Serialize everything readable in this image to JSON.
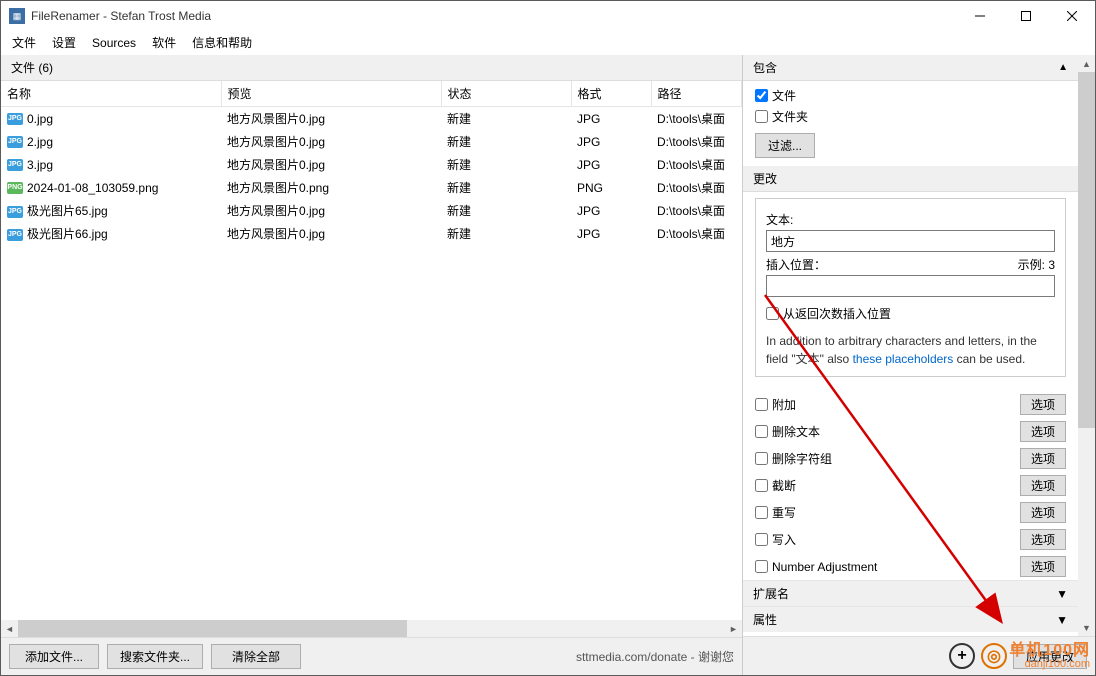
{
  "titlebar": {
    "title": "FileRenamer - Stefan Trost Media"
  },
  "menu": {
    "items": [
      "文件",
      "设置",
      "Sources",
      "软件",
      "信息和帮助"
    ]
  },
  "filelist": {
    "header_label": "文件 (6)",
    "columns": [
      "名称",
      "预览",
      "状态",
      "格式",
      "路径"
    ],
    "rows": [
      {
        "icon": "jpg",
        "name": "0.jpg",
        "preview": "地方风景图片0.jpg",
        "status": "新建",
        "format": "JPG",
        "path": "D:\\tools\\桌面"
      },
      {
        "icon": "jpg",
        "name": "2.jpg",
        "preview": "地方风景图片0.jpg",
        "status": "新建",
        "format": "JPG",
        "path": "D:\\tools\\桌面"
      },
      {
        "icon": "jpg",
        "name": "3.jpg",
        "preview": "地方风景图片0.jpg",
        "status": "新建",
        "format": "JPG",
        "path": "D:\\tools\\桌面"
      },
      {
        "icon": "png",
        "name": "2024-01-08_103059.png",
        "preview": "地方风景图片0.png",
        "status": "新建",
        "format": "PNG",
        "path": "D:\\tools\\桌面"
      },
      {
        "icon": "jpg",
        "name": "极光图片65.jpg",
        "preview": "地方风景图片0.jpg",
        "status": "新建",
        "format": "JPG",
        "path": "D:\\tools\\桌面"
      },
      {
        "icon": "jpg",
        "name": "极光图片66.jpg",
        "preview": "地方风景图片0.jpg",
        "status": "新建",
        "format": "JPG",
        "path": "D:\\tools\\桌面"
      }
    ]
  },
  "bottom": {
    "add_files": "添加文件...",
    "search_files": "搜索文件夹...",
    "clear_all": "清除全部",
    "donate": "sttmedia.com/donate - 谢谢您"
  },
  "right": {
    "include": {
      "header": "包含",
      "files": "文件",
      "folders": "文件夹",
      "filter": "过滤..."
    },
    "change": {
      "header": "更改",
      "text_label": "文本:",
      "text_value": "地方",
      "pos_label": "插入位置：",
      "example_label": "示例: 3",
      "pos_value": "",
      "return_chk": "从返回次数插入位置",
      "note_before": "In addition to arbitrary characters and letters, in the field \"文本\" also ",
      "note_link": "these placeholders",
      "note_after": " can be used."
    },
    "options": [
      {
        "label": "附加",
        "btn": "选项"
      },
      {
        "label": "删除文本",
        "btn": "选项"
      },
      {
        "label": "删除字符组",
        "btn": "选项"
      },
      {
        "label": "截断",
        "btn": "选项"
      },
      {
        "label": "重写",
        "btn": "选项"
      },
      {
        "label": "写入",
        "btn": "选项"
      },
      {
        "label": "Number Adjustment",
        "btn": "选项"
      }
    ],
    "ext_header": "扩展名",
    "attr_header": "属性",
    "apply": "应用更改"
  },
  "watermark": {
    "cn": "单机100网",
    "en": "danji100.com"
  }
}
